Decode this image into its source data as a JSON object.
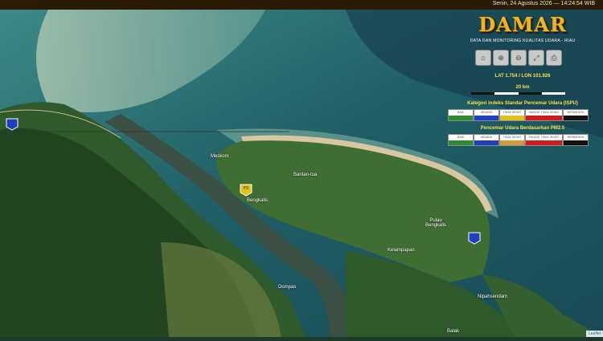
{
  "header": {
    "datetime": "Senin, 24 Agustus 2026 — 14:24:54 WIB"
  },
  "brand": {
    "title": "DAMAR",
    "subtitle": "DATA DAN MONITORING KUALITAS UDARA - RIAU"
  },
  "toolbar": [
    {
      "name": "home-button",
      "icon": "home-icon",
      "glyph": "⌂"
    },
    {
      "name": "zoom-in-button",
      "icon": "zoom-in-icon",
      "glyph": "⊕"
    },
    {
      "name": "zoom-out-button",
      "icon": "zoom-out-icon",
      "glyph": "⊖"
    },
    {
      "name": "fullscreen-button",
      "icon": "expand-icon",
      "glyph": "⤢"
    },
    {
      "name": "print-button",
      "icon": "print-icon",
      "glyph": "⎙"
    }
  ],
  "coordinates": {
    "text": "LAT 1.754 / LON 101.926"
  },
  "scale": {
    "label": "20 km"
  },
  "legend_ispu": {
    "title": "Kategori Indeks Standar Pencemar Udara (ISPU)",
    "items": [
      {
        "label": "BAIK",
        "color": "#2e8b2e"
      },
      {
        "label": "SEDANG",
        "color": "#1f3fbf"
      },
      {
        "label": "TIDAK SEHAT",
        "color": "#e0c21a"
      },
      {
        "label": "SANGAT TIDAK SEHAT",
        "color": "#d01c1c"
      },
      {
        "label": "BERBAHAYA",
        "color": "#111111"
      }
    ]
  },
  "legend_pm25": {
    "title": "Pencemar Udara Berdasarkan PM2.5",
    "items": [
      {
        "label": "BAIK",
        "color": "#2e8b2e"
      },
      {
        "label": "SEDANG",
        "color": "#1f3fbf"
      },
      {
        "label": "TIDAK SEHAT",
        "color": "#d49a3a"
      },
      {
        "label": "SANGAT TIDAK SEHAT",
        "color": "#d01c1c"
      },
      {
        "label": "BERBAHAYA",
        "color": "#111111"
      }
    ]
  },
  "places": [
    {
      "name": "Meskom"
    },
    {
      "name": "Bantan-tua"
    },
    {
      "name": "Bengkalis"
    },
    {
      "name": "Pulau Bengkalis"
    },
    {
      "name": "Kelampapan"
    },
    {
      "name": "Dompas"
    },
    {
      "name": "Nipahsendam"
    },
    {
      "name": "Balak"
    }
  ],
  "markers": [
    {
      "type": "station",
      "color": "#1f3fbf"
    },
    {
      "type": "station",
      "color": "#1f3fbf"
    },
    {
      "type": "station",
      "color": "#e0c21a",
      "label": "PS"
    }
  ],
  "attribution": "Leaflet"
}
